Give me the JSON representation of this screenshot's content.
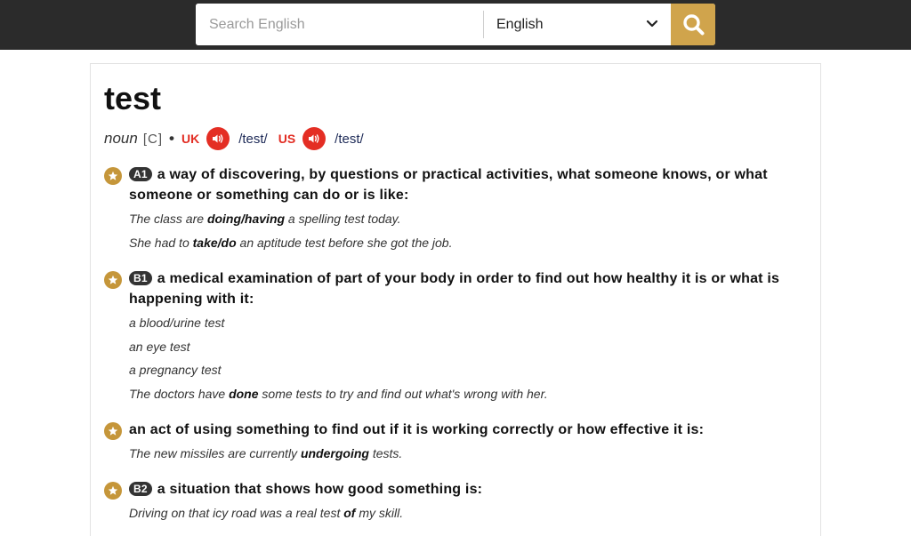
{
  "search": {
    "placeholder": "Search English",
    "language": "English"
  },
  "entry": {
    "headword": "test",
    "pos": "noun",
    "grammar": "[C]",
    "uk_label": "UK",
    "uk_ipa": "/test/",
    "us_label": "US",
    "us_ipa": "/test/"
  },
  "senses": [
    {
      "level": "A1",
      "definition": "a way of discovering, by questions or practical activities, what someone knows, or what someone or something can do or is like:",
      "examples": [
        {
          "pre": "The class are ",
          "bold": "doing/having",
          "post": " a spelling test today."
        },
        {
          "pre": "She had to ",
          "bold": "take/do",
          "post": " an aptitude test before she got the job."
        }
      ]
    },
    {
      "level": "B1",
      "definition": "a medical examination of part of your body in order to find out how healthy it is or what is happening with it:",
      "examples": [
        {
          "pre": "a blood/urine test",
          "bold": "",
          "post": ""
        },
        {
          "pre": "an eye test",
          "bold": "",
          "post": ""
        },
        {
          "pre": "a pregnancy test",
          "bold": "",
          "post": ""
        },
        {
          "pre": "The doctors have ",
          "bold": "done",
          "post": " some tests to try and find out what's wrong with her."
        }
      ]
    },
    {
      "level": "",
      "definition": "an act of using something to find out if it is working correctly or how effective it is:",
      "examples": [
        {
          "pre": "The new missiles are currently ",
          "bold": "undergoing",
          "post": " tests."
        }
      ]
    },
    {
      "level": "B2",
      "definition": "a situation that shows how good something is:",
      "examples": [
        {
          "pre": "Driving on that icy road was a real test ",
          "bold": "of",
          "post": " my skill."
        }
      ]
    }
  ]
}
